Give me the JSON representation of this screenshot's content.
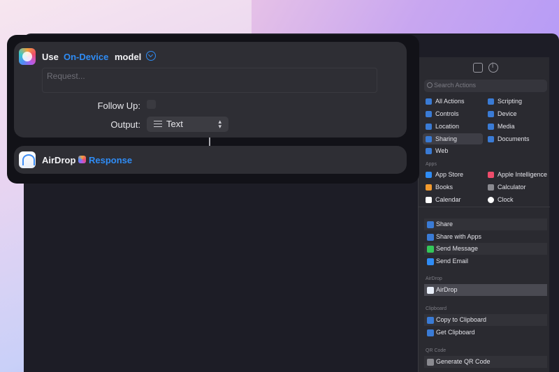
{
  "sidebar": {
    "search_placeholder": "Search Actions",
    "categories": [
      {
        "label": "All Actions",
        "icon": "list-icon",
        "color": "#3a7bd5"
      },
      {
        "label": "Scripting",
        "icon": "scripting-icon",
        "color": "#3a7bd5"
      },
      {
        "label": "Controls",
        "icon": "controls-icon",
        "color": "#3a7bd5"
      },
      {
        "label": "Device",
        "icon": "device-icon",
        "color": "#3a7bd5"
      },
      {
        "label": "Location",
        "icon": "location-icon",
        "color": "#3a7bd5"
      },
      {
        "label": "Media",
        "icon": "media-icon",
        "color": "#3a7bd5"
      },
      {
        "label": "Sharing",
        "icon": "sharing-icon",
        "color": "#3a7bd5",
        "selected": true
      },
      {
        "label": "Documents",
        "icon": "documents-icon",
        "color": "#3a7bd5"
      },
      {
        "label": "Web",
        "icon": "web-icon",
        "color": "#3a7bd5"
      }
    ],
    "apps_label": "Apps",
    "apps": [
      {
        "label": "App Store",
        "icon": "app-store-icon",
        "color": "#2f8cf5"
      },
      {
        "label": "Apple Intelligence",
        "icon": "apple-intelligence-icon",
        "color": "#ee4c6b"
      },
      {
        "label": "Books",
        "icon": "books-icon",
        "color": "#f29a2e"
      },
      {
        "label": "Calculator",
        "icon": "calculator-icon",
        "color": "#8a8a90"
      },
      {
        "label": "Calendar",
        "icon": "calendar-icon",
        "color": "#ffffff"
      },
      {
        "label": "Clock",
        "icon": "clock-icon",
        "color": "#ffffff"
      }
    ],
    "sharing_actions": [
      {
        "label": "Share",
        "icon": "share-icon",
        "color": "#3a7bd5"
      },
      {
        "label": "Share with Apps",
        "icon": "share-apps-icon",
        "color": "#3a7bd5"
      },
      {
        "label": "Send Message",
        "icon": "messages-icon",
        "color": "#34c759"
      },
      {
        "label": "Send Email",
        "icon": "mail-icon",
        "color": "#2f8cf5"
      }
    ],
    "airdrop_label": "AirDrop",
    "airdrop_actions": [
      {
        "label": "AirDrop",
        "icon": "airdrop-icon",
        "color": "#e8eef8"
      }
    ],
    "clipboard_label": "Clipboard",
    "clipboard_actions": [
      {
        "label": "Copy to Clipboard",
        "icon": "clipboard-icon",
        "color": "#3a7bd5"
      },
      {
        "label": "Get Clipboard",
        "icon": "clipboard-icon",
        "color": "#3a7bd5"
      }
    ],
    "qr_label": "QR Code",
    "qr_actions": [
      {
        "label": "Generate QR Code",
        "icon": "qr-code-icon",
        "color": "#8a8a90"
      }
    ]
  },
  "action1": {
    "use": "Use",
    "model_name": "On-Device",
    "model": "model",
    "request_placeholder": "Request...",
    "follow_up_label": "Follow Up:",
    "output_label": "Output:",
    "output_value": "Text"
  },
  "action2": {
    "title": "AirDrop",
    "input": "Response"
  }
}
